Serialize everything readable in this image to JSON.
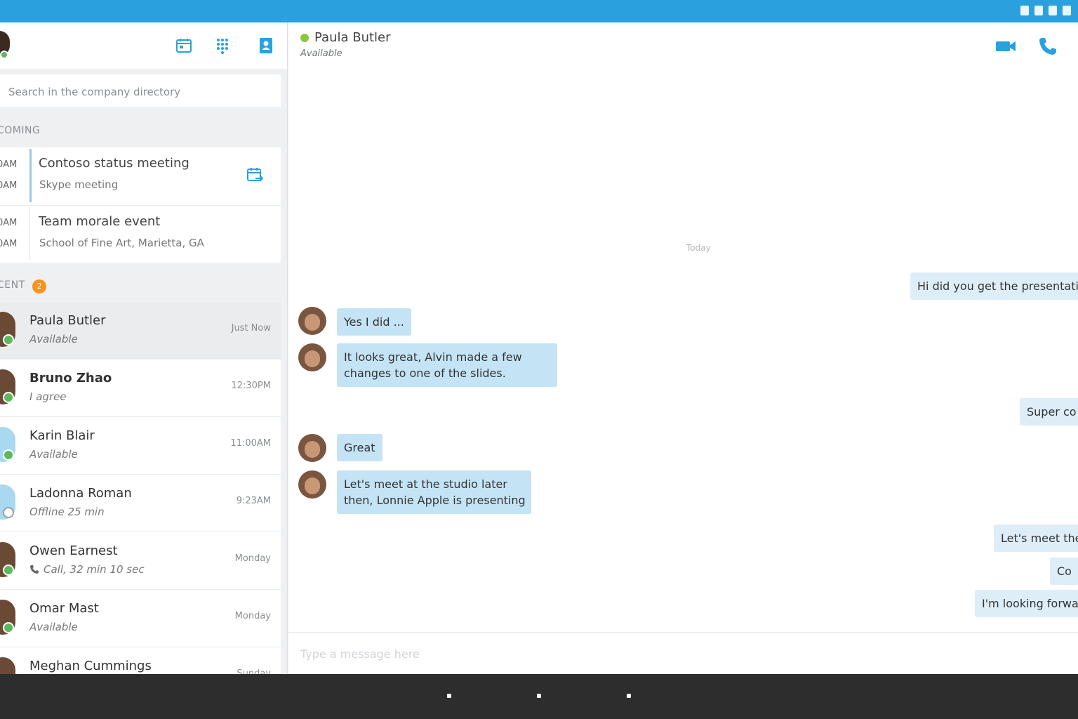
{
  "colors": {
    "accent": "#2aa1de",
    "presence_available": "#5cb85c",
    "badge": "#f7941d",
    "bubble_in": "#c4e4f5",
    "bubble_out": "#deeef8"
  },
  "left": {
    "search_placeholder": "Search in the company directory",
    "upcoming_label": "COMING",
    "meetings": [
      {
        "time_start": "0AM",
        "time_end": "0AM",
        "title": "Contoso status meeting",
        "subtitle": "Skype meeting",
        "icon": "calendar-icon"
      },
      {
        "time_start": "0AM",
        "time_end": "0AM",
        "title": "Team morale event",
        "subtitle": "School of Fine Art, Marietta, GA"
      }
    ],
    "recent_label": "CENT",
    "recent_badge": "2",
    "contacts": [
      {
        "name": "Paula Butler",
        "status": "Available",
        "time": "Just Now"
      },
      {
        "name": "Bruno Zhao",
        "status": "I agree",
        "time": "12:30PM"
      },
      {
        "name": "Karin Blair",
        "status": "Available",
        "time": "11:00AM"
      },
      {
        "name": "Ladonna Roman",
        "status": "Offline 25 min",
        "time": "9:23AM"
      },
      {
        "name": "Owen Earnest",
        "status": "Call, 32 min 10 sec",
        "time": "Monday"
      },
      {
        "name": "Omar Mast",
        "status": "Available",
        "time": "Monday"
      },
      {
        "name": "Meghan Cummings",
        "status": "",
        "time": "Sunday"
      }
    ]
  },
  "conversation": {
    "name": "Paula Butler",
    "status": "Available",
    "day_separator": "Today",
    "messages": [
      {
        "text": "Hi did you get the presentati"
      },
      {
        "text": "Yes I did ..."
      },
      {
        "text": "It looks great, Alvin made a few",
        "text2": "changes to one of the slides."
      },
      {
        "text": "Super co"
      },
      {
        "text": "Great"
      },
      {
        "text": "Let's meet at the studio later",
        "text2": "then, Lonnie Apple is presenting"
      },
      {
        "text": "Let's meet the"
      },
      {
        "text": "Co"
      },
      {
        "text": "I'm looking forwa"
      }
    ],
    "composer_placeholder": "Type a message here"
  }
}
